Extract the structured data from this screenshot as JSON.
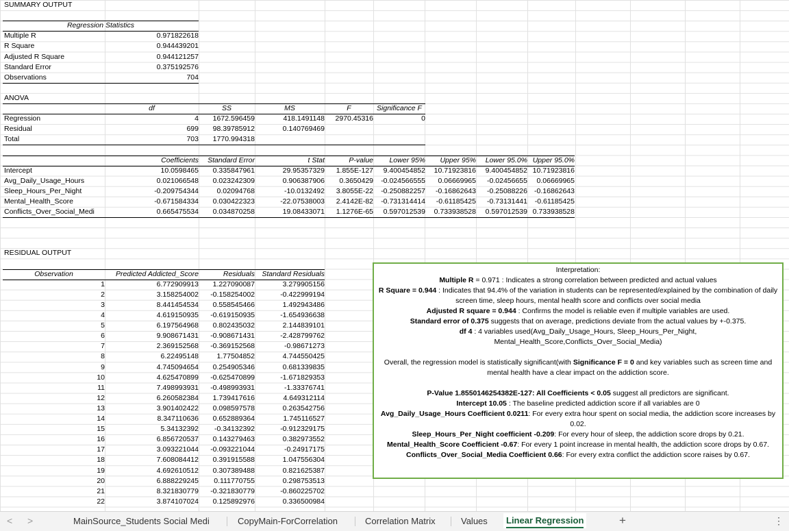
{
  "summary_title": "SUMMARY OUTPUT",
  "regression_stats": {
    "header": "Regression Statistics",
    "rows": [
      {
        "label": "Multiple R",
        "value": "0.971822618"
      },
      {
        "label": "R Square",
        "value": "0.944439201"
      },
      {
        "label": "Adjusted R Square",
        "value": "0.944121257"
      },
      {
        "label": "Standard Error",
        "value": "0.375192576"
      },
      {
        "label": "Observations",
        "value": "704"
      }
    ]
  },
  "anova": {
    "title": "ANOVA",
    "headers": [
      "df",
      "SS",
      "MS",
      "F",
      "Significance F"
    ],
    "rows": [
      {
        "label": "Regression",
        "df": "4",
        "ss": "1672.596459",
        "ms": "418.1491148",
        "f": "2970.45316",
        "sig": "0"
      },
      {
        "label": "Residual",
        "df": "699",
        "ss": "98.39785912",
        "ms": "0.140769469",
        "f": "",
        "sig": ""
      },
      {
        "label": "Total",
        "df": "703",
        "ss": "1770.994318",
        "ms": "",
        "f": "",
        "sig": ""
      }
    ]
  },
  "coefficients": {
    "headers": [
      "Coefficients",
      "Standard Error",
      "t Stat",
      "P-value",
      "Lower 95%",
      "Upper 95%",
      "Lower 95.0%",
      "Upper 95.0%"
    ],
    "rows": [
      {
        "label": "Intercept",
        "v": [
          "10.0598465",
          "0.335847961",
          "29.95357329",
          "1.855E-127",
          "9.400454852",
          "10.71923816",
          "9.400454852",
          "10.71923816"
        ]
      },
      {
        "label": "Avg_Daily_Usage_Hours",
        "v": [
          "0.021066548",
          "0.023242309",
          "0.906387906",
          "0.3650429",
          "-0.024566555",
          "0.06669965",
          "-0.02456655",
          "0.06669965"
        ]
      },
      {
        "label": "Sleep_Hours_Per_Night",
        "v": [
          "-0.209754344",
          "0.02094768",
          "-10.0132492",
          "3.8055E-22",
          "-0.250882257",
          "-0.16862643",
          "-0.25088226",
          "-0.16862643"
        ]
      },
      {
        "label": "Mental_Health_Score",
        "v": [
          "-0.671584334",
          "0.030422323",
          "-22.07538003",
          "2.4142E-82",
          "-0.731314414",
          "-0.61185425",
          "-0.73131441",
          "-0.61185425"
        ]
      },
      {
        "label": "Conflicts_Over_Social_Medi",
        "v": [
          "0.665475534",
          "0.034870258",
          "19.08433071",
          "1.1276E-65",
          "0.597012539",
          "0.733938528",
          "0.597012539",
          "0.733938528"
        ]
      }
    ]
  },
  "residual": {
    "title": "RESIDUAL OUTPUT",
    "headers": [
      "Observation",
      "Predicted Addicted_Score",
      "Residuals",
      "Standard Residuals"
    ],
    "rows": [
      [
        "1",
        "6.772909913",
        "1.227090087",
        "3.279905156"
      ],
      [
        "2",
        "3.158254002",
        "-0.158254002",
        "-0.422999194"
      ],
      [
        "3",
        "8.441454534",
        "0.558545466",
        "1.492943486"
      ],
      [
        "4",
        "4.619150935",
        "-0.619150935",
        "-1.654936638"
      ],
      [
        "5",
        "6.197564968",
        "0.802435032",
        "2.144839101"
      ],
      [
        "6",
        "9.908671431",
        "-0.908671431",
        "-2.428799762"
      ],
      [
        "7",
        "2.369152568",
        "-0.369152568",
        "-0.98671273"
      ],
      [
        "8",
        "6.22495148",
        "1.77504852",
        "4.744550425"
      ],
      [
        "9",
        "4.745094654",
        "0.254905346",
        "0.681339835"
      ],
      [
        "10",
        "4.625470899",
        "-0.625470899",
        "-1.671829353"
      ],
      [
        "11",
        "7.498993931",
        "-0.498993931",
        "-1.33376741"
      ],
      [
        "12",
        "6.260582384",
        "1.739417616",
        "4.649312114"
      ],
      [
        "13",
        "3.901402422",
        "0.098597578",
        "0.263542756"
      ],
      [
        "14",
        "8.347110636",
        "0.652889364",
        "1.745116527"
      ],
      [
        "15",
        "5.34132392",
        "-0.34132392",
        "-0.912329175"
      ],
      [
        "16",
        "6.856720537",
        "0.143279463",
        "0.382973552"
      ],
      [
        "17",
        "3.093221044",
        "-0.093221044",
        "-0.24917175"
      ],
      [
        "18",
        "7.608084412",
        "0.391915588",
        "1.047556304"
      ],
      [
        "19",
        "4.692610512",
        "0.307389488",
        "0.821625387"
      ],
      [
        "20",
        "6.888229245",
        "0.111770755",
        "0.298753513"
      ],
      [
        "21",
        "8.321830779",
        "-0.321830779",
        "-0.860225702"
      ],
      [
        "22",
        "3.874107024",
        "0.125892976",
        "0.336500984"
      ]
    ]
  },
  "interpretation": {
    "title": "Interpretation:",
    "lines": [
      {
        "b": "Multiple R",
        "t": " = 0.971 : Indicates a strong correlation between predicted and actual values"
      },
      {
        "b": "R Square = 0.944",
        "t": " : Indicates that 94.4% of the variation in students can be represented/explained by the combination of daily screen time, sleep hours, mental health score and conflicts over social media"
      },
      {
        "b": "Adjusted R square = 0.944",
        "t": " : Confirms the model is reliable even if multiple variables are used."
      },
      {
        "b": "Standard error of 0.375",
        "t": " suggests that on average, predictions deviate from the actual values by +-0.375."
      },
      {
        "b": "df 4",
        "t": " : 4 variables used(Avg_Daily_Usage_Hours, Sleep_Hours_Per_Night, Mental_Health_Score,Conflicts_Over_Social_Media)"
      }
    ],
    "overall_a": "Overall, the regression model is statistically significant(with ",
    "overall_b": "Significance F = 0",
    "overall_c": " and key variables such as screen time and mental health have a clear impact on the addiction score.",
    "lines2": [
      {
        "b": "P-Value 1.8550146254382E-127: All Coefficients < 0.05",
        "t": " suggest all predictors are significant."
      },
      {
        "b": "Intercept 10.05",
        "t": " : The baseline predicted addiction score if all variables are 0"
      },
      {
        "b": "Avg_Daily_Usage_Hours Coefficient 0.0211",
        "t": ": For every extra hour spent on social media, the addiction score increases by 0.02."
      },
      {
        "b": "Sleep_Hours_Per_Night coefficient -0.209",
        "t": ": For every hour of sleep, the addiction score drops by 0.21."
      },
      {
        "b": "Mental_Health_Score Coefficient -0.67",
        "t": ": For every 1 point increase in mental health, the addiction score drops by 0.67."
      },
      {
        "b": "Conflicts_Over_Social_Media Coefficient 0.66",
        "t": ": For every extra conflict the addiction score raises by 0.67."
      }
    ]
  },
  "tabs": {
    "items": [
      "MainSource_Students Social Medi",
      "CopyMain-ForCorrelation",
      "Correlation Matrix",
      "Values",
      "Linear Regression"
    ],
    "active": "Linear Regression",
    "add": "+",
    "prev": "<",
    "next": ">",
    "more": "⋮"
  }
}
